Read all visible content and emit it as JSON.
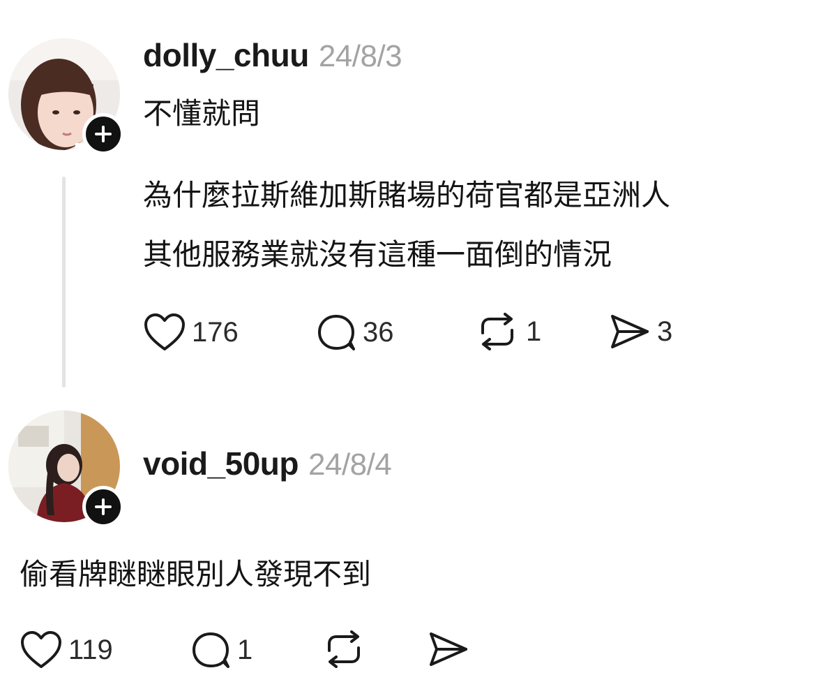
{
  "post1": {
    "username": "dolly_chuu",
    "date": "24/8/3",
    "text_line1": "不懂就問",
    "text_line2": "為什麼拉斯維加斯賭場的荷官都是亞洲人",
    "text_line3": "其他服務業就沒有這種一面倒的情況",
    "likes": "176",
    "comments": "36",
    "reposts": "1",
    "shares": "3"
  },
  "post2": {
    "username": "void_50up",
    "date": "24/8/4",
    "text_line1": "偷看牌瞇瞇眼別人發現不到",
    "likes": "119",
    "comments": "1"
  },
  "icons": {
    "like": "heart-icon",
    "comment": "speech-bubble-icon",
    "repost": "repost-icon",
    "share": "send-icon",
    "follow": "plus-icon"
  }
}
